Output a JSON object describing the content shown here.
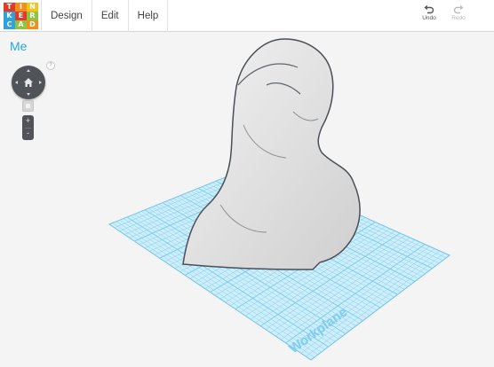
{
  "app": {
    "logo_letters": [
      "T",
      "I",
      "N",
      "K",
      "E",
      "R",
      "C",
      "A",
      "D"
    ],
    "logo_colors": [
      "#e23a26",
      "#f28e1c",
      "#f9c21b",
      "#2fa1dc",
      "#e23a26",
      "#8cc63f",
      "#2fa1dc",
      "#8cc63f",
      "#f28e1c"
    ]
  },
  "menu": {
    "items": [
      {
        "label": "Design"
      },
      {
        "label": "Edit"
      },
      {
        "label": "Help"
      }
    ]
  },
  "toolbar": {
    "undo_label": "Undo",
    "redo_label": "Redo",
    "redo_enabled": false
  },
  "sidebar": {
    "user_name": "Me",
    "help_glyph": "?",
    "zoom_in_glyph": "+",
    "zoom_out_glyph": "-"
  },
  "icons": {
    "home": "home-icon",
    "undo": "undo-arrow-icon",
    "redo": "redo-arrow-icon",
    "fit": "cube-icon"
  },
  "workplane": {
    "label": "Workplane",
    "grid_color": "#7fcdee",
    "fill_color": "#cfeefb",
    "model_color": "#e6e6e6"
  },
  "colors": {
    "accent": "#27a6d9",
    "nav_dark": "#505459"
  }
}
